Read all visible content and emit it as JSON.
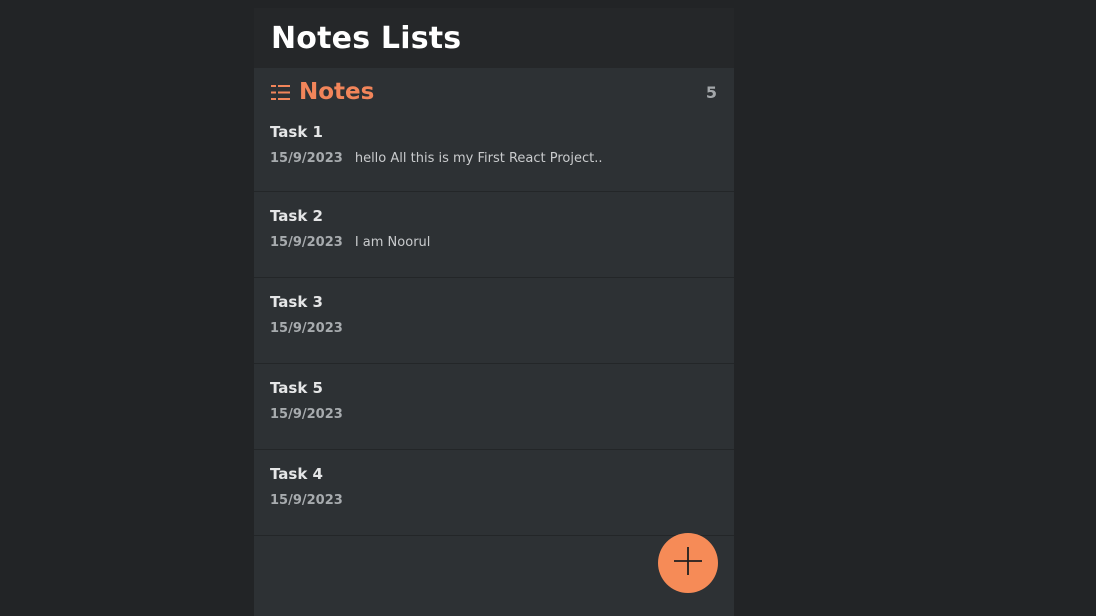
{
  "header": {
    "title": "Notes Lists"
  },
  "notes_section": {
    "label": "Notes",
    "count": "5",
    "icon": "list-icon"
  },
  "notes": [
    {
      "title": "Task 1",
      "date": "15/9/2023",
      "preview": "hello All this is my First React Project.."
    },
    {
      "title": "Task 2",
      "date": "15/9/2023",
      "preview": "I am Noorul"
    },
    {
      "title": "Task 3",
      "date": "15/9/2023",
      "preview": ""
    },
    {
      "title": "Task 5",
      "date": "15/9/2023",
      "preview": ""
    },
    {
      "title": "Task 4",
      "date": "15/9/2023",
      "preview": ""
    }
  ],
  "fab": {
    "icon": "plus-icon"
  },
  "colors": {
    "accent": "#f2855a",
    "fab": "#f68b57",
    "background": "#222426",
    "panel": "#2d3134",
    "header": "#252729"
  }
}
